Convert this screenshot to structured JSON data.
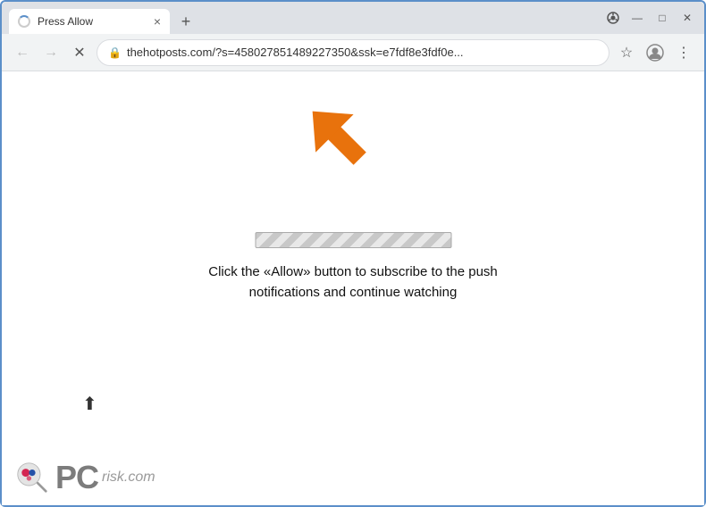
{
  "window": {
    "title": "Press Allow",
    "tab_title": "Press Allow"
  },
  "browser": {
    "url": "thehotposts.com/?s=458027851489227350&ssk=e7fdf8e3fdf0e...",
    "url_full": "thehotposts.com/?s=458027851489227350&ssk=e7fdf8e3fdf0e...",
    "back_label": "←",
    "forward_label": "→",
    "close_tab_label": "×",
    "new_tab_label": "+"
  },
  "page": {
    "message": "Click the «Allow» button to subscribe to the push notifications and continue watching",
    "progress_bar_alt": "loading bar"
  },
  "watermark": {
    "site": "pcrisk.com",
    "logo_text_pc": "PC",
    "logo_text_risk": "risk.com"
  },
  "window_controls": {
    "minimize": "—",
    "maximize": "□",
    "close": "✕"
  }
}
